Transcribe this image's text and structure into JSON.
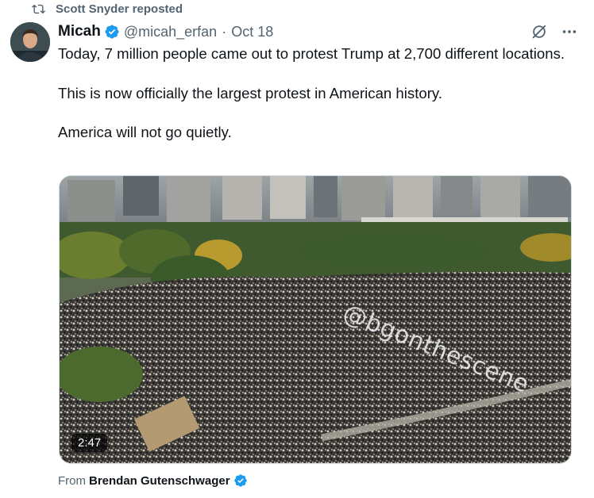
{
  "repost": {
    "text": "Scott Snyder reposted",
    "icon": "repost-icon"
  },
  "author": {
    "name": "Micah",
    "handle": "@micah_erfan",
    "date": "Oct 18",
    "verified": true,
    "verified_color": "#1d9bf0"
  },
  "tweet": {
    "paragraphs": [
      "Today, 7 million people came out to protest Trump at 2,700 different locations.",
      "This is now officially the largest protest in American history.",
      "America will not go quietly."
    ]
  },
  "media": {
    "duration": "2:47",
    "watermark": "@bgonthescene"
  },
  "attribution": {
    "prefix": "From",
    "name": "Brendan Gutenschwager",
    "verified": true
  },
  "icons": {
    "grok": "grok-icon",
    "more": "more-icon"
  },
  "colors": {
    "secondary_text": "#536471",
    "primary_text": "#0f1419",
    "accent": "#1d9bf0"
  }
}
